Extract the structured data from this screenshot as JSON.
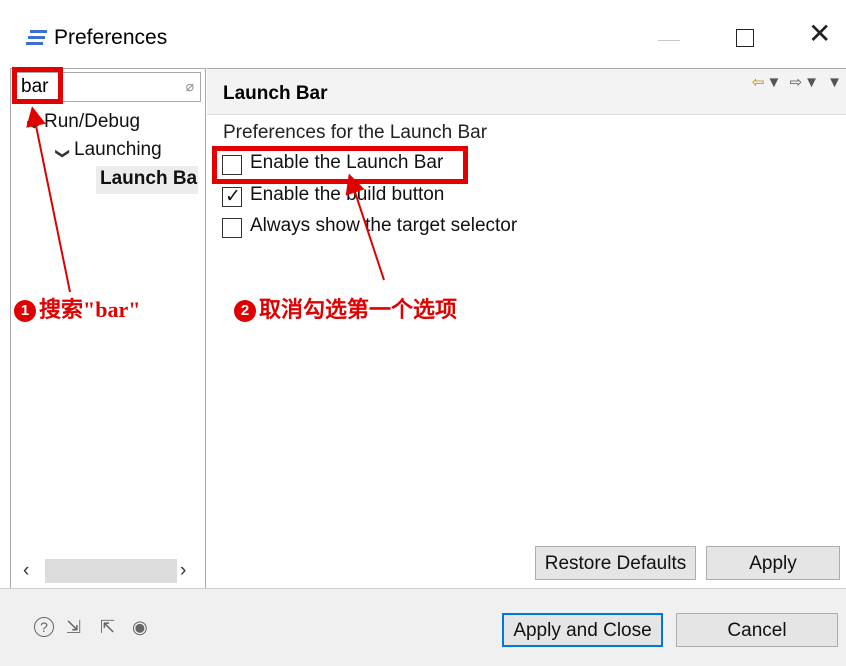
{
  "window": {
    "title": "Preferences",
    "minimize_icon": "minimize-icon",
    "maximize_icon": "maximize-icon",
    "close_icon": "close-icon",
    "close_glyph": "✕"
  },
  "filter": {
    "value": "bar",
    "clear_icon": "eraser-icon",
    "clear_glyph": "⌀"
  },
  "tree": {
    "items": [
      {
        "label": "Run/Debug",
        "expanded": true
      },
      {
        "label": "Launching",
        "expanded": true
      },
      {
        "label": "Launch Ba",
        "selected": true
      }
    ],
    "expand_glyph": "❯"
  },
  "scrollbar": {
    "left_glyph": "‹",
    "right_glyph": "›"
  },
  "page": {
    "title": "Launch Bar",
    "description": "Preferences for the Launch Bar",
    "nav_back_glyph": "⇦",
    "nav_forward_glyph": "⇨",
    "nav_menu_glyph": "▼",
    "options": [
      {
        "label": "Enable the Launch Bar",
        "checked": false
      },
      {
        "label": "Enable the build button",
        "checked": true
      },
      {
        "label": "Always show the target selector",
        "checked": false
      }
    ],
    "check_glyph": "✓"
  },
  "buttons": {
    "restore_defaults": "Restore Defaults",
    "apply": "Apply",
    "apply_and_close": "Apply and Close",
    "cancel": "Cancel"
  },
  "bottom_icons": {
    "help_glyph": "?",
    "import_glyph": "⇲",
    "export_glyph": "⇱",
    "record_glyph": "◉"
  },
  "annotations": {
    "step1_number": "1",
    "step1_text": "搜索\"bar\"",
    "step2_number": "2",
    "step2_text": "取消勾选第一个选项",
    "accent": "#e00000"
  },
  "colors": {
    "default_button_border": "#0078d7",
    "annotation_red": "#e00000"
  }
}
